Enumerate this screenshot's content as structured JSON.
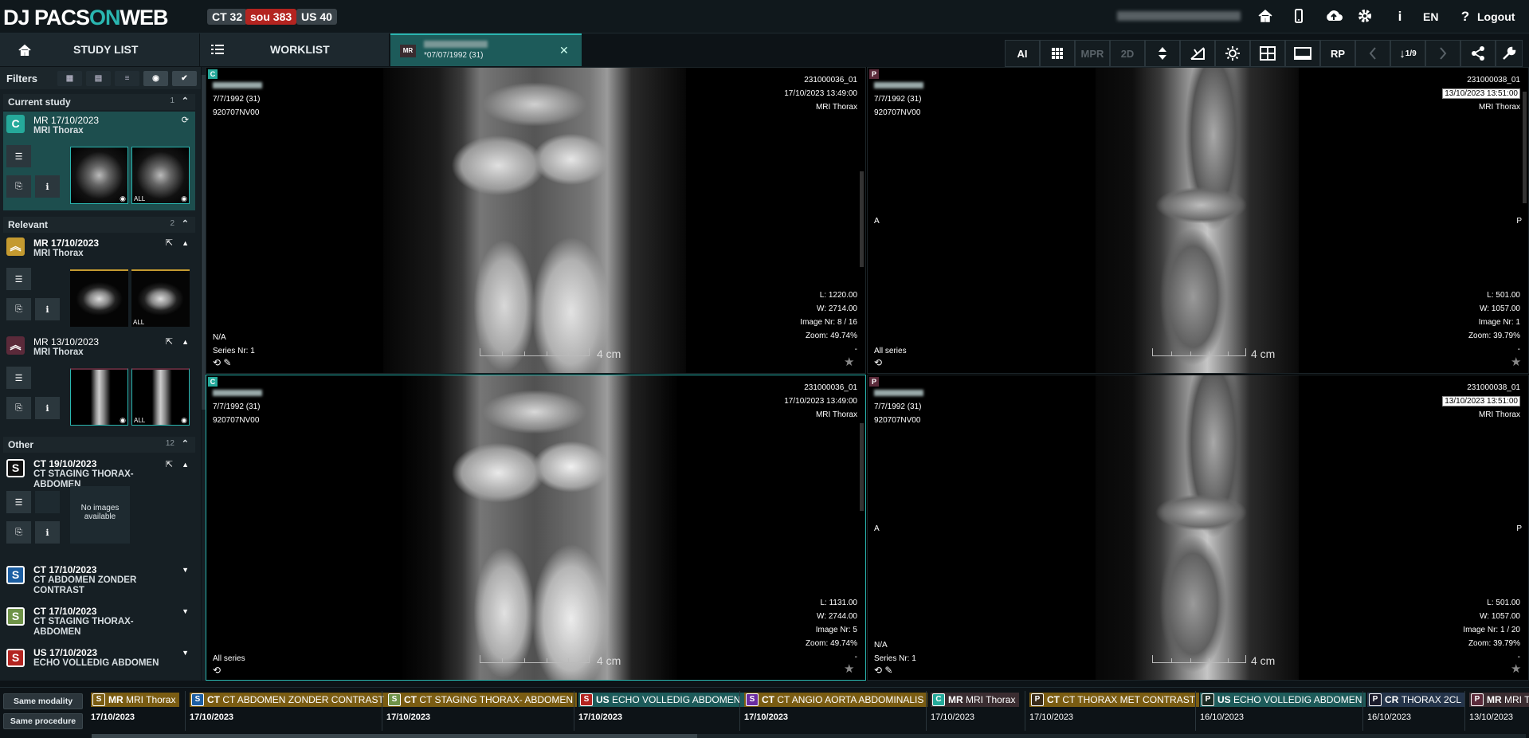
{
  "header": {
    "logo_prefix": "DJ PACS",
    "logo_on": "ON",
    "logo_suffix": "WEB",
    "badges": [
      {
        "label": "CT 32",
        "color": "#3a4349"
      },
      {
        "label": "sou 383",
        "color": "#b32420"
      },
      {
        "label": "US 40",
        "color": "#3a4349"
      }
    ],
    "icons": [
      "home-icon",
      "mobile-icon",
      "cloud-upload-icon",
      "gear-icon",
      "info-icon"
    ],
    "language": "EN",
    "help": "?",
    "logout": "Logout"
  },
  "nav": {
    "study_list": "STUDY LIST",
    "worklist": "WORKLIST",
    "active_tab": {
      "modality": "MR",
      "dob": "*07/07/1992 (31)"
    }
  },
  "toolbar": {
    "ai": "AI",
    "mpr": "MPR",
    "twod": "2D",
    "rp": "RP",
    "series_counter": "1/9",
    "icons": [
      "grid-icon",
      "scroll-arrows-icon",
      "no-sync-icon",
      "brightness-icon",
      "layout-icon",
      "fullscreen-icon",
      "prev-icon",
      "sort-icon",
      "next-icon",
      "share-icon",
      "tools-icon"
    ]
  },
  "sidebar": {
    "filters_label": "Filters",
    "current": {
      "title": "Current study",
      "count": "1",
      "letter": "C",
      "modality_date": "MR 17/10/2023",
      "description": "MRI Thorax",
      "thumb2_label": "ALL"
    },
    "relevant": {
      "title": "Relevant",
      "count": "2",
      "items": [
        {
          "modality": "MR",
          "date": "17/10/2023",
          "description": "MRI Thorax",
          "thumb_label": "ALL"
        },
        {
          "modality": "MR",
          "date": "13/10/2023",
          "description": "MRI Thorax",
          "thumb_label": "ALL"
        }
      ]
    },
    "other": {
      "title": "Other",
      "count": "12",
      "items": [
        {
          "letter": "S",
          "modality": "CT",
          "date": "19/10/2023",
          "description": "CT STAGING THORAX-ABDOMEN",
          "no_images": "No images available"
        },
        {
          "letter": "S",
          "modality": "CT",
          "date": "17/10/2023",
          "description": "CT ABDOMEN ZONDER CONTRAST"
        },
        {
          "letter": "S",
          "modality": "CT",
          "date": "17/10/2023",
          "description": "CT STAGING THORAX-ABDOMEN"
        },
        {
          "letter": "S",
          "modality": "US",
          "date": "17/10/2023",
          "description": "ECHO VOLLEDIG ABDOMEN"
        }
      ]
    }
  },
  "viewports": [
    {
      "badge": "C",
      "dob": "7/7/1992 (31)",
      "pid": "920707NV00",
      "acc": "231000036_01",
      "datetime": "17/10/2023 13:49:00",
      "study": "MRI Thorax",
      "level": "L: 1220.00",
      "width": "W: 2714.00",
      "image": "Image Nr: 8 / 16",
      "zoom": "Zoom: 49.74%",
      "dash": "-",
      "left_a": "N/A",
      "left_b": "Series Nr: 1",
      "ruler": "4 cm"
    },
    {
      "badge": "P",
      "dob": "7/7/1992 (31)",
      "pid": "920707NV00",
      "acc": "231000038_01",
      "datetime": "13/10/2023 13:51:00",
      "study": "MRI Thorax",
      "level": "L: 501.00",
      "width": "W: 1057.00",
      "image": "Image Nr: 1",
      "zoom": "Zoom: 39.79%",
      "dash": "-",
      "left_a": "",
      "left_b": "All series",
      "ruler": "4 cm",
      "orient_l": "A",
      "orient_r": "P"
    },
    {
      "badge": "C",
      "dob": "7/7/1992 (31)",
      "pid": "920707NV00",
      "acc": "231000036_01",
      "datetime": "17/10/2023 13:49:00",
      "study": "MRI Thorax",
      "level": "L: 1131.00",
      "width": "W: 2744.00",
      "image": "Image Nr: 5",
      "zoom": "Zoom: 49.74%",
      "dash": "-",
      "left_a": "",
      "left_b": "All series",
      "ruler": "4 cm"
    },
    {
      "badge": "P",
      "dob": "7/7/1992 (31)",
      "pid": "920707NV00",
      "acc": "231000038_01",
      "datetime": "13/10/2023 13:51:00",
      "study": "MRI Thorax",
      "level": "L: 501.00",
      "width": "W: 1057.00",
      "image": "Image Nr: 1 / 20",
      "zoom": "Zoom: 39.79%",
      "dash": "-",
      "left_a": "N/A",
      "left_b": "Series Nr: 1",
      "ruler": "4 cm",
      "orient_l": "A",
      "orient_r": "P"
    }
  ],
  "bottom": {
    "same_modality": "Same modality",
    "same_procedure": "Same procedure",
    "studies": [
      {
        "letter": "S",
        "mod": "MR",
        "desc": "MRI Thorax",
        "date": "17/10/2023",
        "color": "#7a5c12"
      },
      {
        "letter": "S",
        "mod": "CT",
        "desc": "CT ABDOMEN ZONDER CONTRAST",
        "date": "17/10/2023",
        "color": "#7a5c12"
      },
      {
        "letter": "S",
        "mod": "CT",
        "desc": "CT STAGING THORAX- ABDOMEN",
        "date": "17/10/2023",
        "color": "#7a5c12"
      },
      {
        "letter": "S",
        "mod": "US",
        "desc": "ECHO VOLLEDIG ABDOMEN",
        "date": "17/10/2023",
        "color": "#1d5b5a"
      },
      {
        "letter": "S",
        "mod": "CT",
        "desc": "CT ANGIO AORTA ABDOMINALIS",
        "date": "17/10/2023",
        "color": "#7a5c12"
      },
      {
        "letter": "C",
        "mod": "MR",
        "desc": "MRI Thorax",
        "date": "17/10/2023",
        "color": "#3a2c30"
      },
      {
        "letter": "P",
        "mod": "CT",
        "desc": "CT THORAX MET CONTRAST",
        "date": "17/10/2023",
        "color": "#7a5c12"
      },
      {
        "letter": "P",
        "mod": "US",
        "desc": "ECHO VOLLEDIG ABDOMEN",
        "date": "16/10/2023",
        "color": "#1d5b5a"
      },
      {
        "letter": "P",
        "mod": "CR",
        "desc": "THORAX 2CL",
        "date": "16/10/2023",
        "color": "#24344a"
      },
      {
        "letter": "P",
        "mod": "MR",
        "desc": "MRI T",
        "date": "13/10/2023",
        "color": "#3a2c30"
      }
    ]
  }
}
